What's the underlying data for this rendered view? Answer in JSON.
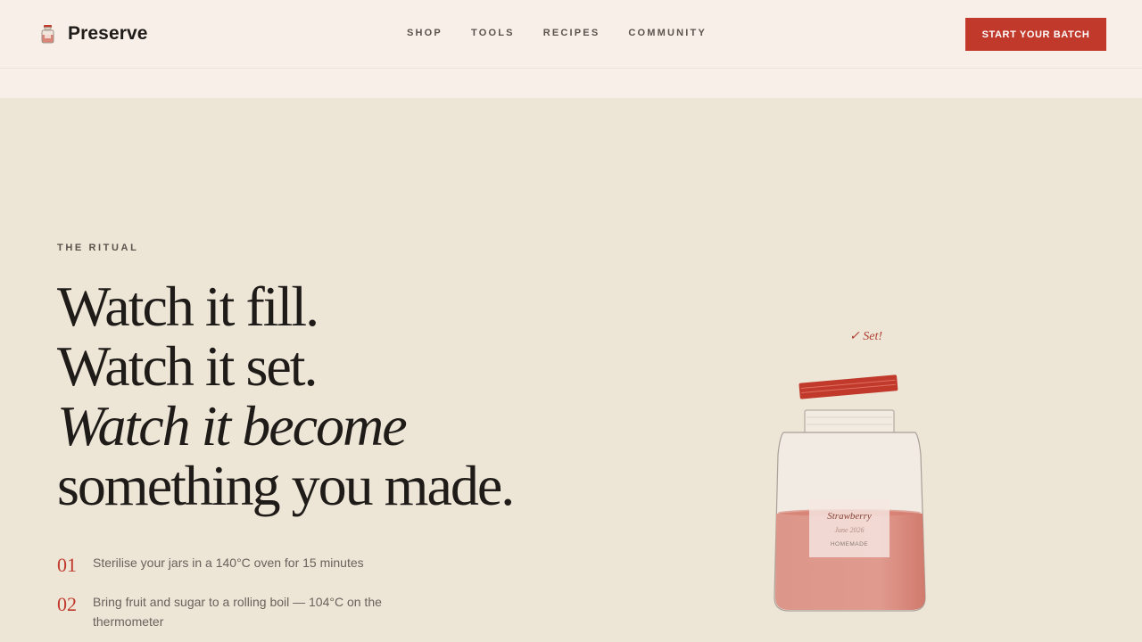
{
  "brand": {
    "name": "Preserve",
    "icon": "jar-icon"
  },
  "nav": [
    {
      "label": "SHOP"
    },
    {
      "label": "TOOLS"
    },
    {
      "label": "RECIPES"
    },
    {
      "label": "COMMUNITY"
    }
  ],
  "cta": {
    "label": "START YOUR BATCH"
  },
  "hero": {
    "eyebrow": "THE RITUAL",
    "line1": "Watch it fill.",
    "line2": "Watch it set.",
    "line3": "Watch it become",
    "line4": "something you made."
  },
  "steps": [
    {
      "num": "01",
      "text": "Sterilise your jars in a 140°C oven for 15 minutes"
    },
    {
      "num": "02",
      "text": "Bring fruit and sugar to a rolling boil — 104°C on the thermometer"
    }
  ],
  "jar": {
    "status": "✓ Set!",
    "label_flavor": "Strawberry",
    "label_date": "June 2026",
    "label_tag": "HOMEMADE",
    "fill_color": "#d98678",
    "lid_color": "#c0392b"
  },
  "colors": {
    "accent": "#c0392b",
    "background": "#ede5d6",
    "header": "#f7efe8"
  }
}
